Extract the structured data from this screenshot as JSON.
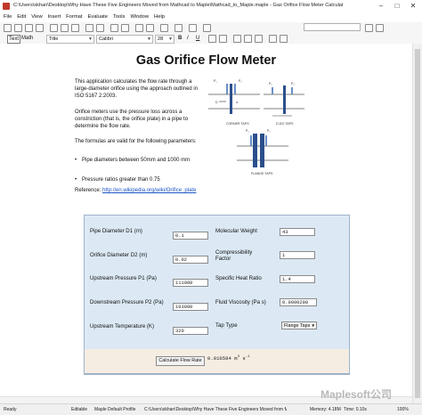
{
  "window": {
    "title": "C:\\Users\\skhan\\Desktop\\Why Have These Five Engineers Moved from Mathcad to Maple\\Mathcad_to_Maple.maple - Gas Orifice Flow Meter Calculator.mw* - [Server ..."
  },
  "menu": [
    "File",
    "Edit",
    "View",
    "Insert",
    "Format",
    "Evaluate",
    "Tools",
    "Window",
    "Help"
  ],
  "toolbar": {
    "search_placeholder": "",
    "text_mode": "Text",
    "math_mode": "Math",
    "style": "Title",
    "font": "Calibri",
    "size": "28",
    "bold": "B",
    "italic": "I",
    "underline": "U"
  },
  "document": {
    "title": "Gas Orifice Flow Meter",
    "paragraphs": [
      "This application calculates the flow rate through a large-diameter orifice using the approach outlined in ISO 5167 2:2003.",
      "Orifice meters use the pressure loss across a constriction (that is, the orifice plate) in a pipe to determine the flow rate.",
      "The formulas are valid for the following parameters:"
    ],
    "bullets": [
      "Pipe diameters between 50mm and 1000 mm",
      "Pressure ratios greater than 0.75"
    ],
    "reference_label": "Reference: ",
    "reference_link": "http://en.wikipedia.org/wiki/Orifice_plate",
    "diagram_labels": {
      "corner": "CORNER TAPS",
      "d_d2": "D-D/2 TAPS",
      "flange": "FLANGE TAPS"
    }
  },
  "form": {
    "pipe_diameter_d1": {
      "label": "Pipe Diameter D1 (m)",
      "value": "0.1"
    },
    "orifice_diameter_d2": {
      "label": "Orifice Diameter D2 (m)",
      "value": "0.02"
    },
    "upstream_pressure_p1": {
      "label": "Upstream Pressure P1 (Pa)",
      "value": "111000"
    },
    "downstream_pressure_p2": {
      "label": "Downstream Pressure P2 (Pa)",
      "value": "103000"
    },
    "upstream_temperature": {
      "label": "Upstream Temperature (K)",
      "value": "320"
    },
    "molecular_weight": {
      "label": "Molecular Weight",
      "value": "43"
    },
    "compressibility_factor": {
      "label": "Compressibility Factor",
      "value": "1"
    },
    "specific_heat_ratio": {
      "label": "Specific Heat Ratio",
      "value": "1.4"
    },
    "fluid_viscosity": {
      "label": "Fluid Viscosity (Pa s)",
      "value": "0.0000208"
    },
    "tap_type": {
      "label": "Tap Type",
      "value": "Flange Taps"
    },
    "calculate_button": "Calculate Flow Rate",
    "result": "0.016584",
    "result_unit": "m",
    "result_unit_exp": "3",
    "result_unit_s": "s",
    "result_unit_s_exp": "-1"
  },
  "status": {
    "ready": "Ready",
    "editable": "Editable",
    "profile": "Maple Default Profile",
    "path": "C:\\Users\\skhan\\Desktop\\Why Have These Five Engineers Moved from Mathcad to Maple",
    "memory": "Memory: 4.18M",
    "time": "Time: 0.10s",
    "zoom": "100%"
  },
  "watermark": "Maplesoft公司"
}
